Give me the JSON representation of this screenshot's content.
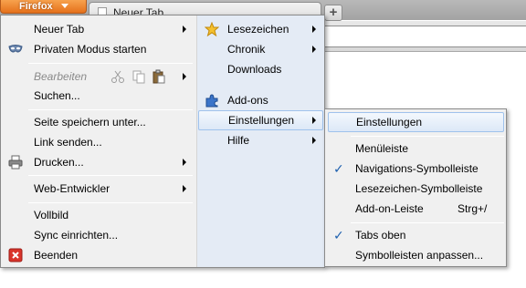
{
  "browser": {
    "app_button": "Firefox",
    "tab_title": "Neuer Tab",
    "new_tab_symbol": "+"
  },
  "main_menu": {
    "left": [
      {
        "label": "Neuer Tab",
        "submenu": true
      },
      {
        "label": "Privaten Modus starten",
        "icon": "private-mode-mask-icon"
      },
      {
        "label": "Bearbeiten",
        "disabled": true,
        "submenu": true,
        "icons": [
          "cut-icon",
          "copy-icon",
          "paste-icon"
        ]
      },
      {
        "label": "Suchen..."
      },
      {
        "label": "Seite speichern unter..."
      },
      {
        "label": "Link senden..."
      },
      {
        "label": "Drucken...",
        "icon": "printer-icon",
        "submenu": true
      },
      {
        "label": "Web-Entwickler",
        "submenu": true
      },
      {
        "label": "Vollbild"
      },
      {
        "label": "Sync einrichten..."
      },
      {
        "label": "Beenden",
        "icon": "quit-icon"
      }
    ],
    "right": [
      {
        "label": "Lesezeichen",
        "icon": "star-icon",
        "submenu": true
      },
      {
        "label": "Chronik",
        "submenu": true
      },
      {
        "label": "Downloads"
      },
      {
        "label": "Add-ons",
        "icon": "puzzle-icon"
      },
      {
        "label": "Einstellungen",
        "submenu": true,
        "highlighted": true
      },
      {
        "label": "Hilfe",
        "submenu": true
      }
    ]
  },
  "settings_submenu": {
    "items": [
      {
        "label": "Einstellungen",
        "highlighted": true
      },
      {
        "label": "Menüleiste",
        "checked": false
      },
      {
        "label": "Navigations-Symbolleiste",
        "checked": true
      },
      {
        "label": "Lesezeichen-Symbolleiste",
        "checked": false
      },
      {
        "label": "Add-on-Leiste",
        "shortcut": "Strg+/",
        "checked": false
      },
      {
        "label": "Tabs oben",
        "checked": true
      },
      {
        "label": "Symbolleisten anpassen..."
      }
    ]
  },
  "colors": {
    "firefox_button": "#e5711b",
    "highlight_border": "#9fc2ec",
    "check_mark": "#1d5fae"
  }
}
